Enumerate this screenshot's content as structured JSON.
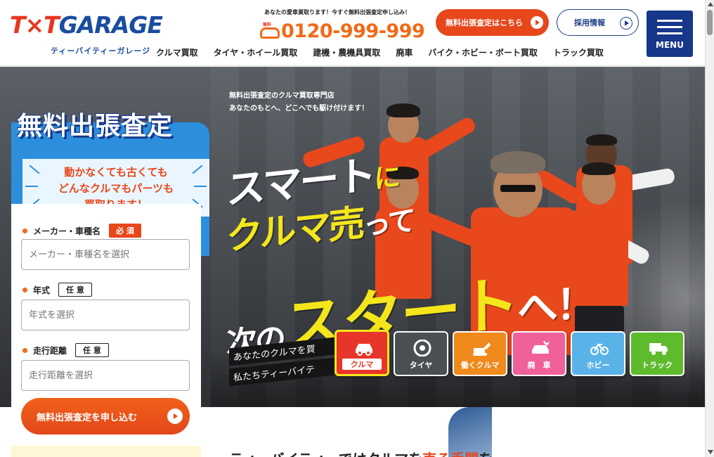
{
  "header": {
    "logo_main": "T×T GARAGE",
    "logo_sub": "ティーバイティーガレージ",
    "tel_note": "あなたの愛車買取ります！今すぐ無料出張査定申し込み！",
    "tel_free_label": "無料",
    "tel_number": "0120-999-999",
    "assess_button": "無料出張査定はこちら",
    "recruit_button": "採用情報",
    "menu_label": "MENU",
    "nav": [
      "クルマ買取",
      "タイヤ・ホイール買取",
      "建機・農機具買取",
      "廃車",
      "バイク・ホビー・ボート買取",
      "トラック買取"
    ]
  },
  "hero": {
    "tag_line1": "無料出張査定のクルマ買取専門店",
    "tag_line2": "あなたのもとへ、どこへでも駆け付けます！",
    "catch1_a": "スマート",
    "catch1_b": "に",
    "catch2_a": "クルマ売",
    "catch2_b": "って",
    "catch3_a": "次の",
    "catch3_b": "スタート",
    "catch3_c": "へ！",
    "slogan_line1": "あなたのクルマを買",
    "slogan_line2": "私たちティーバイテ",
    "categories": [
      {
        "label": "クルマ",
        "color": "#e8352a",
        "icon": "car-icon"
      },
      {
        "label": "タイヤ",
        "color": "#4a4f52",
        "icon": "tire-icon"
      },
      {
        "label": "働くクルマ",
        "color": "#f08a1d",
        "icon": "excavator-icon"
      },
      {
        "label": "廃　車",
        "color": "#f0609b",
        "icon": "scrap-car-icon"
      },
      {
        "label": "ホビー",
        "color": "#5ab3e8",
        "icon": "bicycle-icon"
      },
      {
        "label": "トラック",
        "color": "#5dbb2c",
        "icon": "truck-icon"
      }
    ]
  },
  "form": {
    "title": "無料出張査定",
    "subtitle_line1": "動かなくても古くても",
    "subtitle_line2": "どんなクルマもパーツも",
    "subtitle_line3": "買取ります！",
    "fields": [
      {
        "label": "メーカー・車種名",
        "badge": "必 須",
        "placeholder": "メーカー・車種名を選択"
      },
      {
        "label": "年式",
        "badge": "任 意",
        "placeholder": "年式を選択"
      },
      {
        "label": "走行距離",
        "badge": "任 意",
        "placeholder": "走行距離を選択"
      }
    ],
    "submit": "無料出張査定を申し込む"
  },
  "below": {
    "title_a": "ティーバイティーではクルマを",
    "title_hl": "売る手間",
    "title_b": "を"
  },
  "colors": {
    "brand_blue": "#16378a",
    "accent_orange": "#e8471c",
    "tel_orange": "#f06a18",
    "form_blue": "#2b8fde",
    "highlight_yellow": "#f4e61b"
  }
}
